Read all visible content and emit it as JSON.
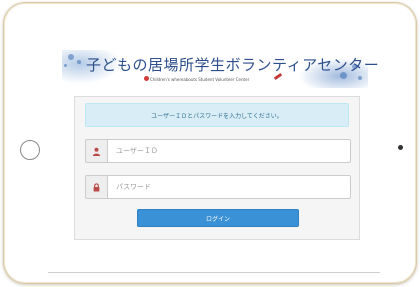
{
  "header": {
    "title": "子どもの居場所学生ボランティアセンター",
    "subtitle": "Children's whereabouts Student Volunteer Center"
  },
  "login": {
    "message": "ユーザーＩＤとパスワードを入力してください。",
    "user_id": {
      "placeholder": "ユーザーＩＤ",
      "icon": "user-icon",
      "icon_color": "#b94a48"
    },
    "password": {
      "placeholder": "パスワード",
      "icon": "lock-icon",
      "icon_color": "#b94a48"
    },
    "submit_label": "ログイン"
  },
  "colors": {
    "accent": "#3a91d6",
    "alert_bg": "#d9edf7",
    "title": "#2d4f8c"
  }
}
